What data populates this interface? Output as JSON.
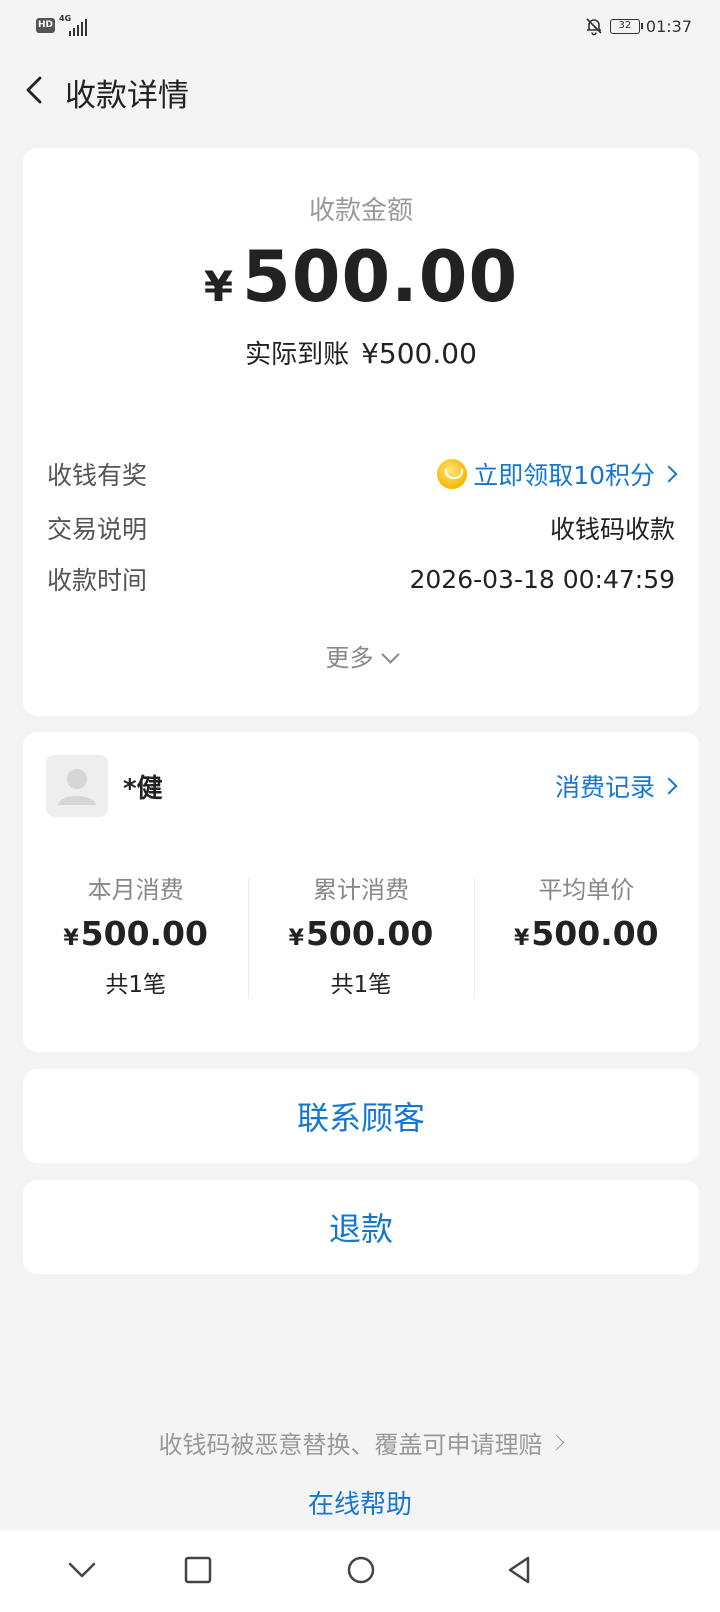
{
  "status_bar": {
    "hd_badge": "HD",
    "network_type": "4G",
    "battery_level": "32",
    "time": "01:37",
    "icons": [
      "signal-icon",
      "mute-bell-icon",
      "battery-icon"
    ]
  },
  "header": {
    "title": "收款详情",
    "back_icon": "chevron-left-icon"
  },
  "payment": {
    "amount_label": "收款金额",
    "currency_symbol": "¥",
    "amount": "500.00",
    "received_label": "实际到账",
    "received_value": "¥500.00",
    "details": [
      {
        "key": "收钱有奖",
        "value": "立即领取10积分"
      },
      {
        "key": "交易说明",
        "value": "收钱码收款"
      },
      {
        "key": "收款时间",
        "value": "2026-03-18 00:47:59"
      }
    ],
    "more_label": "更多"
  },
  "customer": {
    "name": "*健",
    "records_link": "消费记录",
    "stats": [
      {
        "label": "本月消费",
        "currency": "¥",
        "value": "500.00",
        "count": "共1笔"
      },
      {
        "label": "累计消费",
        "currency": "¥",
        "value": "500.00",
        "count": "共1笔"
      },
      {
        "label": "平均单价",
        "currency": "¥",
        "value": "500.00",
        "count": ""
      }
    ]
  },
  "actions": {
    "contact_label": "联系顾客",
    "refund_label": "退款"
  },
  "footer": {
    "claim_text": "收钱码被恶意替换、覆盖可申请理赔",
    "help_link": "在线帮助"
  },
  "colors": {
    "accent": "#1677d3",
    "background": "#f4f4f4",
    "card": "#ffffff",
    "coin": "#f5b800"
  }
}
